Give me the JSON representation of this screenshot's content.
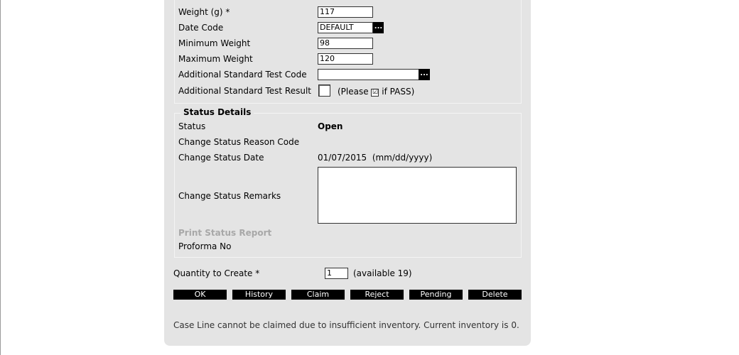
{
  "form": {
    "weight_label": "Weight (g) *",
    "weight_value": "117",
    "date_code_label": "Date Code",
    "date_code_value": "DEFAULT",
    "min_weight_label": "Minimum Weight",
    "min_weight_value": "98",
    "max_weight_label": "Maximum Weight",
    "max_weight_value": "120",
    "addl_test_code_label": "Additional Standard Test Code",
    "addl_test_code_value": "",
    "addl_test_result_label": "Additional Standard Test Result",
    "addl_test_result_hint_prefix": "(Please",
    "addl_test_result_hint_check": "☑",
    "addl_test_result_hint_suffix": "if PASS)",
    "picker_label": "..."
  },
  "status": {
    "legend": "Status Details",
    "status_label": "Status",
    "status_value": "Open",
    "reason_code_label": "Change Status Reason Code",
    "date_label": "Change Status Date",
    "date_value": "01/07/2015",
    "date_format": "(mm/dd/yyyy)",
    "remarks_label": "Change Status Remarks",
    "remarks_value": "",
    "print_report_label": "Print Status Report",
    "proforma_label": "Proforma No"
  },
  "quantity": {
    "label": "Quantity to Create *",
    "value": "1",
    "available": "(available 19)"
  },
  "buttons": [
    "OK",
    "History",
    "Claim",
    "Reject",
    "Pending",
    "Delete"
  ],
  "message": "Case Line cannot be claimed due to insufficient inventory. Current inventory is 0."
}
